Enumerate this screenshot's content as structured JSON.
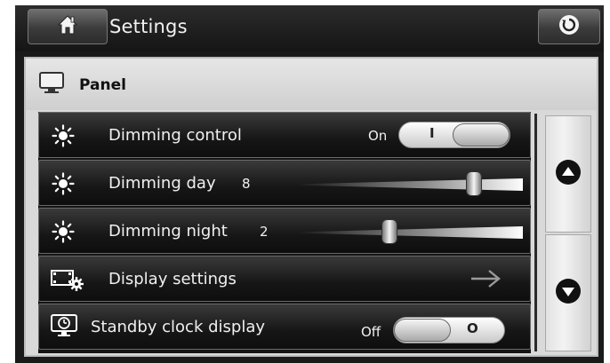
{
  "header": {
    "title": "Settings",
    "home_icon": "home-icon",
    "back_icon": "back-icon"
  },
  "panel": {
    "title": "Panel",
    "icon": "monitor-icon"
  },
  "rows": [
    {
      "label": "Dimming control",
      "icon": "sun-icon",
      "type": "toggle",
      "state_label": "On",
      "toggle_mark": "I",
      "state": true
    },
    {
      "label": "Dimming day",
      "icon": "sun-icon",
      "type": "slider",
      "value": "8",
      "level": 0.78
    },
    {
      "label": "Dimming night",
      "icon": "sun-icon",
      "type": "slider",
      "value": "2",
      "level": 0.4
    },
    {
      "label": "Display settings",
      "icon": "display-settings-icon",
      "type": "link"
    },
    {
      "label": "Standby clock display",
      "icon": "clock-display-icon",
      "type": "toggle",
      "state_label": "Off",
      "toggle_mark": "O",
      "state": false
    }
  ],
  "scroll": {
    "up_icon": "arrow-up-icon",
    "down_icon": "arrow-down-icon"
  },
  "colors": {
    "accent": "#ffffff",
    "bar_dark": "#151515",
    "panel_bg": "#d9d9d9"
  }
}
